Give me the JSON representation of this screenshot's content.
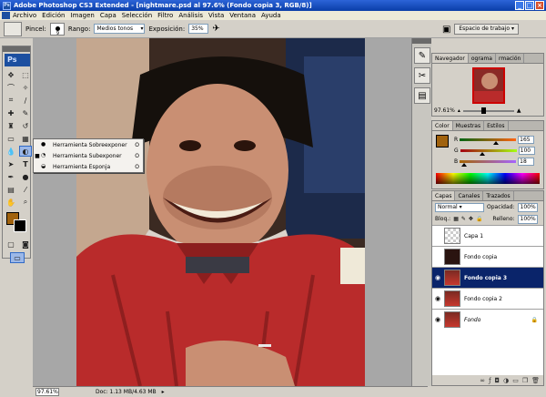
{
  "window": {
    "title": "Adobe Photoshop CS3 Extended - [nightmare.psd al 97.6% (Fondo copia 3, RGB/8)]"
  },
  "menu": [
    "Archivo",
    "Edición",
    "Imagen",
    "Capa",
    "Selección",
    "Filtro",
    "Análisis",
    "Vista",
    "Ventana",
    "Ayuda"
  ],
  "options": {
    "brush_label": "Pincel:",
    "brush_size": "9",
    "range_label": "Rango:",
    "range_value": "Medios tonos",
    "exposure_label": "Exposición:",
    "exposure_value": "35%",
    "workspace_label": "Espacio de trabajo"
  },
  "toolbox": {
    "logo": "Ps",
    "foreground_color": "#a0620e",
    "background_color": "#000000"
  },
  "flyout": {
    "items": [
      {
        "label": "Herramienta Sobreexponer",
        "key": "O",
        "selected": false
      },
      {
        "label": "Herramienta Subexponer",
        "key": "O",
        "selected": true
      },
      {
        "label": "Herramienta Esponja",
        "key": "O",
        "selected": false
      }
    ]
  },
  "status": {
    "zoom": "97.61%",
    "doc": "Doc: 1.13 MB/4.63 MB"
  },
  "navigator": {
    "tabs": [
      "Navegador",
      "ograma",
      "rmación"
    ],
    "zoom": "97.61%",
    "zoom_level": 0.4
  },
  "color": {
    "tabs": [
      "Color",
      "Muestras",
      "Estilos"
    ],
    "r": "165",
    "g": "100",
    "b": "18"
  },
  "layers": {
    "tabs": [
      "Capas",
      "Canales",
      "Trazados"
    ],
    "blend_mode": "Normal",
    "opacity_label": "Opacidad:",
    "opacity_value": "100%",
    "lock_label": "Bloq.:",
    "fill_label": "Relleno:",
    "fill_value": "100%",
    "items": [
      {
        "name": "Capa 1",
        "visible": false,
        "selected": false
      },
      {
        "name": "Fondo copia",
        "visible": false,
        "selected": false
      },
      {
        "name": "Fondo copia 3",
        "visible": true,
        "selected": true
      },
      {
        "name": "Fondo copia 2",
        "visible": true,
        "selected": false
      },
      {
        "name": "Fondo",
        "visible": true,
        "selected": false,
        "locked": true
      }
    ]
  }
}
